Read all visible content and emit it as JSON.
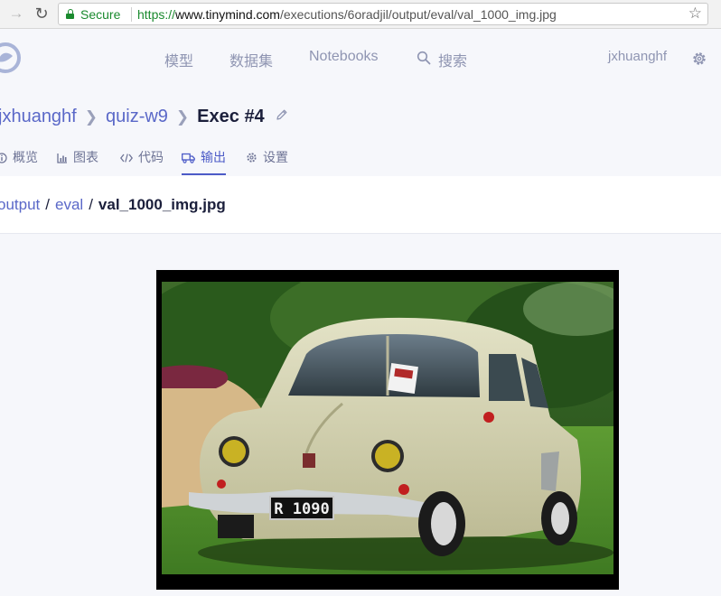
{
  "browser": {
    "secure_label": "Secure",
    "url_scheme": "https://",
    "url_host": "www.tinymind.com",
    "url_path": "/executions/6oradjil/output/eval/val_1000_img.jpg"
  },
  "header": {
    "nav": [
      "模型",
      "数据集",
      "Notebooks",
      "搜索"
    ],
    "username": "jxhuanghf"
  },
  "breadcrumb": {
    "user": "jxhuanghf",
    "project": "quiz-w9",
    "current": "Exec #4"
  },
  "tabs": [
    {
      "label": "概览",
      "icon": "info-icon"
    },
    {
      "label": "图表",
      "icon": "chart-icon"
    },
    {
      "label": "代码",
      "icon": "code-icon"
    },
    {
      "label": "输出",
      "icon": "truck-icon",
      "active": true
    },
    {
      "label": "设置",
      "icon": "gear-icon"
    }
  ],
  "file_path": {
    "segments": [
      "output",
      "eval"
    ],
    "current": "val_1000_img.jpg"
  },
  "image": {
    "plate_text": "R 1090"
  },
  "colors": {
    "accent": "#4c5bc7",
    "secure": "#1a8a2e",
    "muted_nav": "#8f95b2"
  }
}
